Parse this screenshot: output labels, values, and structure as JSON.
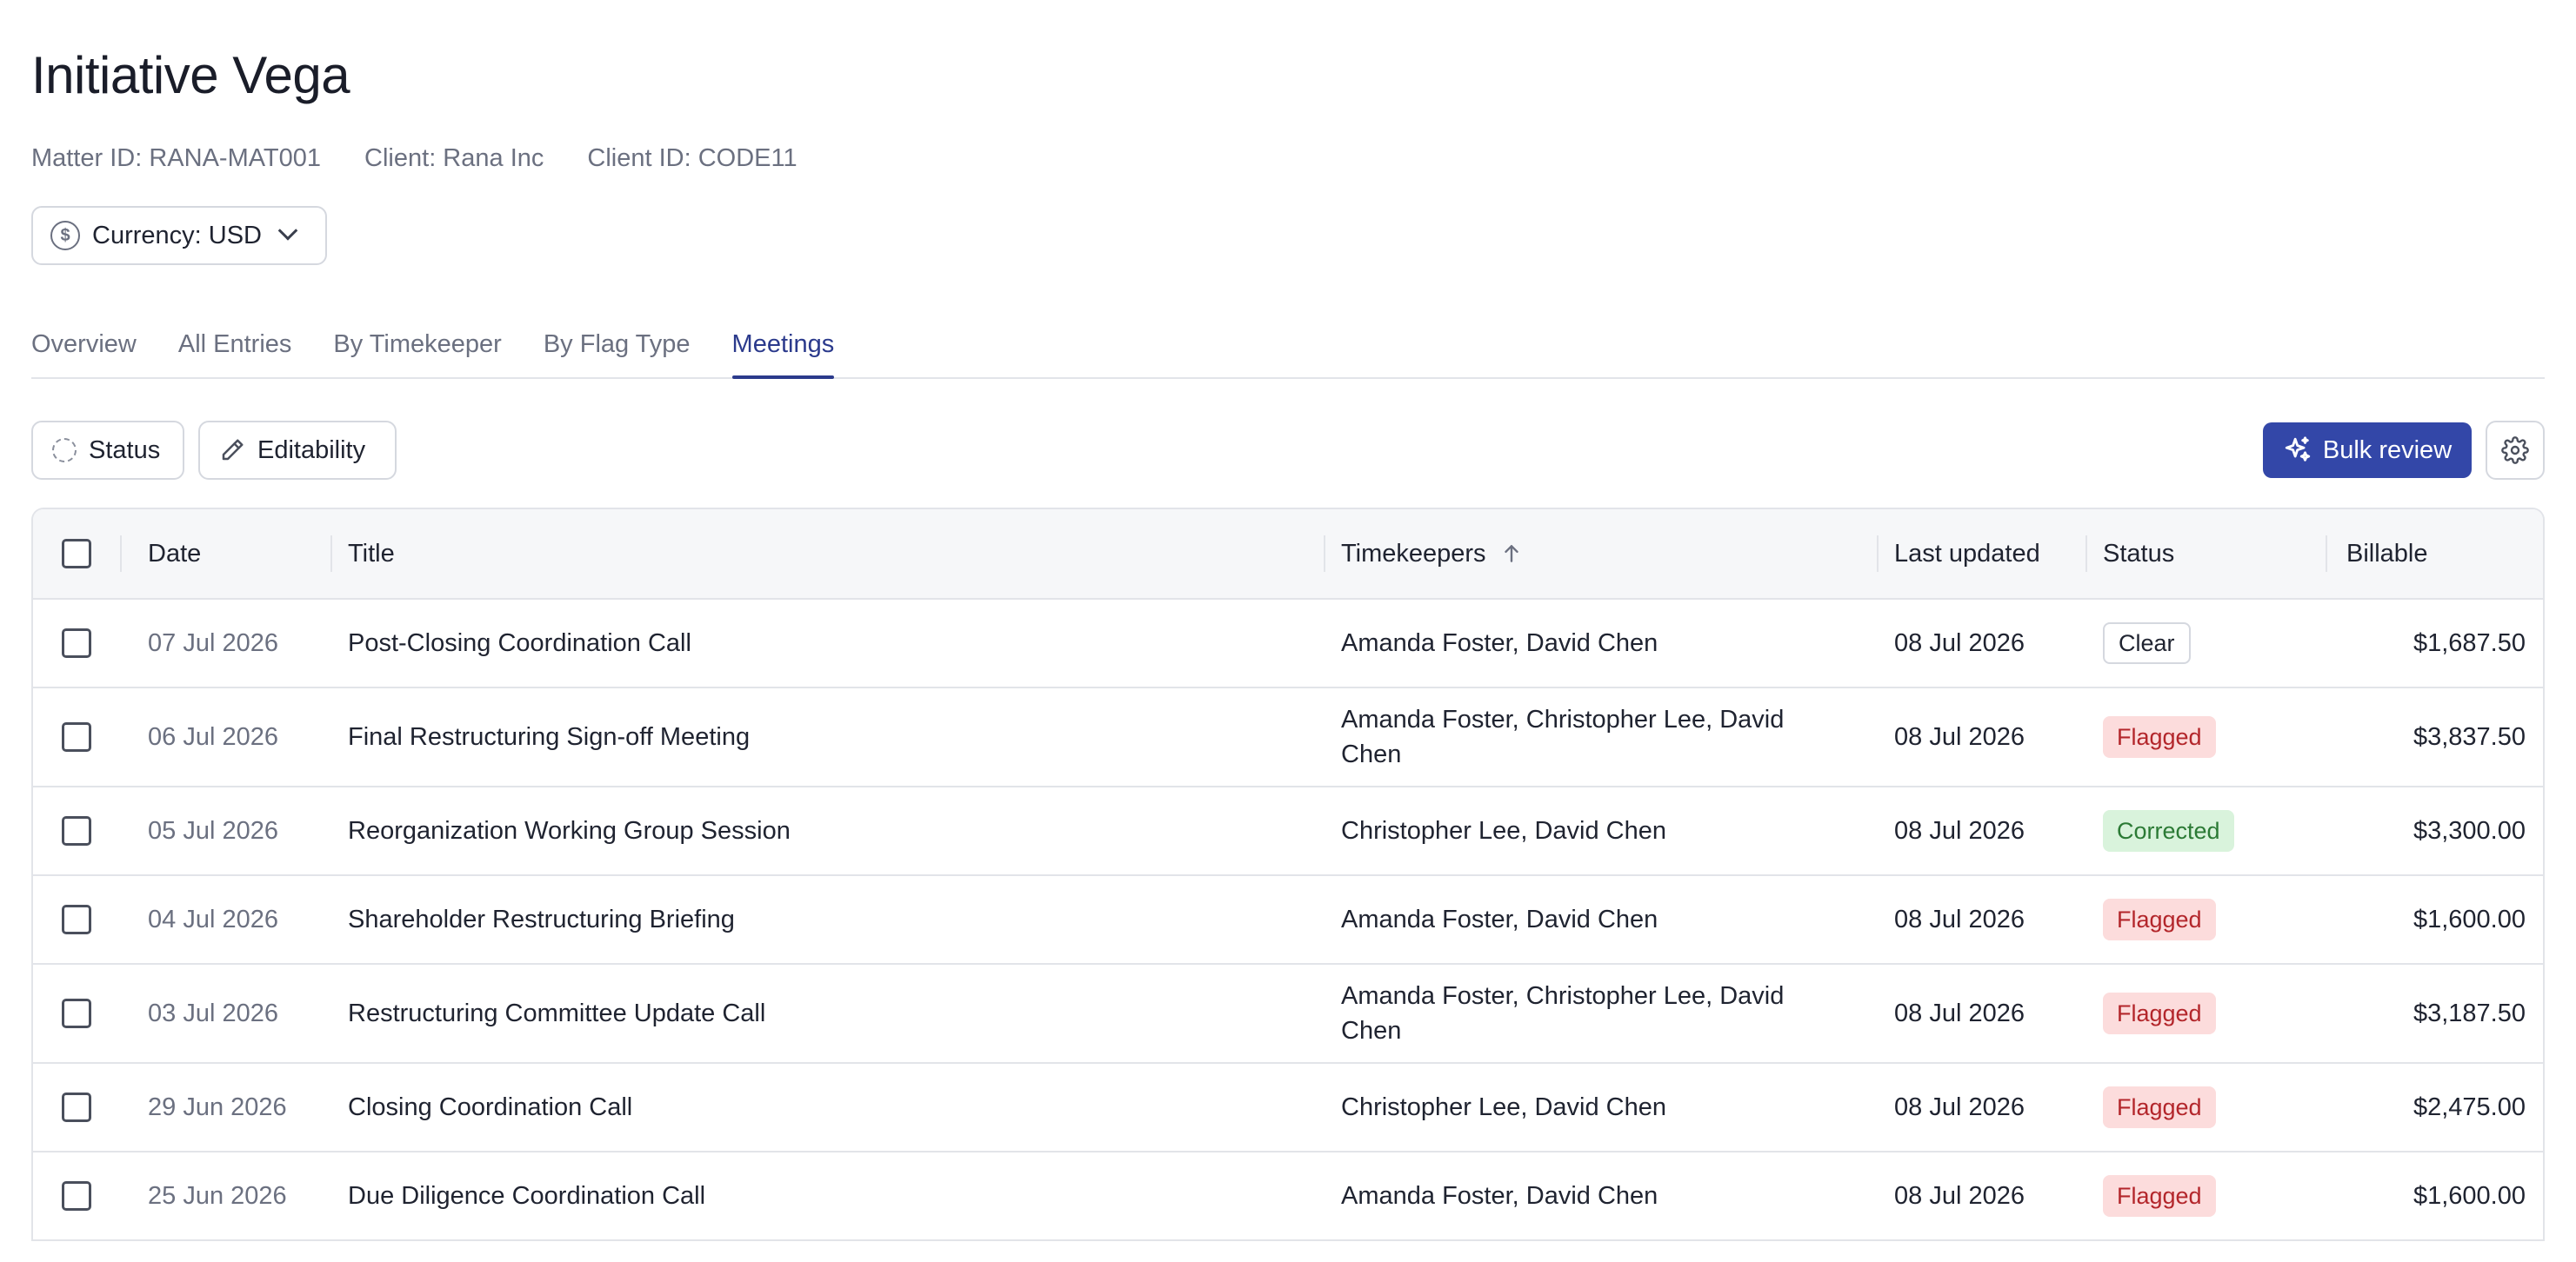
{
  "header": {
    "title": "Initiative Vega",
    "matter_id": "Matter ID: RANA-MAT001",
    "client": "Client:  Rana Inc",
    "client_id": "Client ID: CODE11"
  },
  "currency": {
    "label": "Currency: USD",
    "icon": "dollar-circle-icon"
  },
  "tabs": [
    {
      "label": "Overview",
      "active": false
    },
    {
      "label": "All Entries",
      "active": false
    },
    {
      "label": "By Timekeeper",
      "active": false
    },
    {
      "label": "By Flag Type",
      "active": false
    },
    {
      "label": "Meetings",
      "active": true
    }
  ],
  "filters": {
    "status_label": "Status",
    "editability_label": "Editability",
    "bulk_review_label": "Bulk review"
  },
  "table": {
    "columns": {
      "date": "Date",
      "title": "Title",
      "timekeepers": "Timekeepers",
      "last_updated": "Last updated",
      "status": "Status",
      "billable": "Billable"
    },
    "sort": {
      "column": "Timekeepers",
      "direction": "ascending"
    },
    "rows": [
      {
        "date": "07 Jul 2026",
        "title": "Post-Closing Coordination Call",
        "timekeepers": "Amanda Foster, David Chen",
        "last_updated": "08 Jul 2026",
        "status": "Clear",
        "billable": "$1,687.50"
      },
      {
        "date": "06 Jul 2026",
        "title": "Final Restructuring Sign-off Meeting",
        "timekeepers": "Amanda Foster, Christopher Lee, David Chen",
        "last_updated": "08 Jul 2026",
        "status": "Flagged",
        "billable": "$3,837.50"
      },
      {
        "date": "05 Jul 2026",
        "title": "Reorganization Working Group Session",
        "timekeepers": "Christopher Lee, David Chen",
        "last_updated": "08 Jul 2026",
        "status": "Corrected",
        "billable": "$3,300.00"
      },
      {
        "date": "04 Jul 2026",
        "title": "Shareholder Restructuring Briefing",
        "timekeepers": "Amanda Foster, David Chen",
        "last_updated": "08 Jul 2026",
        "status": "Flagged",
        "billable": "$1,600.00"
      },
      {
        "date": "03 Jul 2026",
        "title": "Restructuring Committee Update Call",
        "timekeepers": "Amanda Foster, Christopher Lee, David Chen",
        "last_updated": "08 Jul 2026",
        "status": "Flagged",
        "billable": "$3,187.50"
      },
      {
        "date": "29 Jun 2026",
        "title": "Closing Coordination Call",
        "timekeepers": "Christopher Lee, David Chen",
        "last_updated": "08 Jul 2026",
        "status": "Flagged",
        "billable": "$2,475.00"
      },
      {
        "date": "25 Jun 2026",
        "title": "Due Diligence Coordination Call",
        "timekeepers": "Amanda Foster, David Chen",
        "last_updated": "08 Jul 2026",
        "status": "Flagged",
        "billable": "$1,600.00"
      }
    ]
  },
  "colors": {
    "accent": "#2b3a8c",
    "bulk_button": "#3347a8",
    "flagged_bg": "#fcdcdc",
    "flagged_text": "#b3262b",
    "corrected_bg": "#d9f3dc",
    "corrected_text": "#2b7a35"
  }
}
